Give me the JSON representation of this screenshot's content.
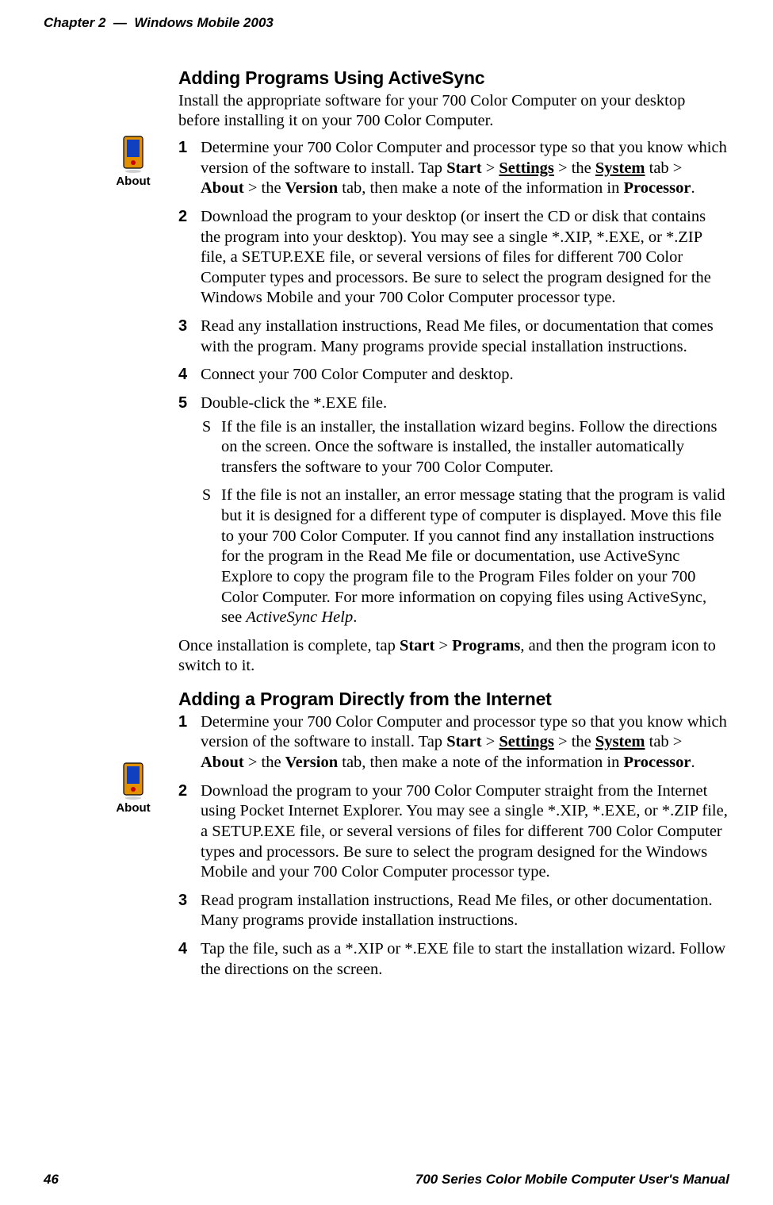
{
  "header": {
    "chapter": "Chapter 2",
    "dash": "—",
    "subject": "Windows Mobile 2003"
  },
  "footer": {
    "pageNum": "46",
    "manualTitle": "700 Series Color Mobile Computer User's Manual"
  },
  "icon": {
    "caption": "About"
  },
  "s1": {
    "title": "Adding Programs Using ActiveSync",
    "intro": "Install the appropriate software for your 700 Color Computer on your desktop before installing it on your 700 Color Computer.",
    "items": [
      {
        "n": "1",
        "pre1": "Determine your 700 Color Computer and processor type so that you know which version of the software to install. Tap ",
        "b1": "Start",
        "gt1": " > ",
        "u1": "Settings",
        "gt2": " > the ",
        "u2": "System",
        "post1": " tab > ",
        "b2": "About",
        "gt3": " > the ",
        "b3": "Version",
        "post2": " tab, then make a note of the information in ",
        "b4": "Processor",
        "post3": "."
      },
      {
        "n": "2",
        "text": "Download the program to your desktop (or insert the CD or disk that contains the program into your desktop). You may see a single *.XIP, *.EXE, or *.ZIP file, a SETUP.EXE file, or several versions of files for different 700 Color Computer types and processors. Be sure to select the program designed for the Windows Mobile and your 700 Color Computer processor type."
      },
      {
        "n": "3",
        "text": "Read any installation instructions, Read Me files, or documentation that comes with the program. Many programs provide special installation instructions."
      },
      {
        "n": "4",
        "text": "Connect your 700 Color Computer and desktop."
      },
      {
        "n": "5",
        "text": "Double-click the *.EXE file.",
        "sub": [
          "If the file is an installer, the installation wizard begins. Follow the directions on the screen. Once the software is installed, the installer automatically transfers the software to your 700 Color Computer.",
          {
            "pre": "If the file is not an installer, an error message stating that the program is valid but it is designed for a different type of computer is displayed. Move this file to your 700 Color Computer. If you cannot find any installation instructions for the program in the Read Me file or documentation, use ActiveSync Explore to copy the program file to the Program Files folder on your 700 Color Computer. For more information on copying files using ActiveSync, see ",
            "ital": "ActiveSync Help",
            "post": "."
          }
        ]
      }
    ],
    "outro": {
      "pre": "Once installation is complete, tap ",
      "b1": "Start",
      "gt": " > ",
      "b2": "Programs",
      "post": ", and then the program icon to switch to it."
    }
  },
  "s2": {
    "title": "Adding a Program Directly from the Internet",
    "items": [
      {
        "n": "1",
        "pre1": "Determine your 700 Color Computer and processor type so that you know which version of the software to install. Tap ",
        "b1": "Start",
        "gt1": " > ",
        "u1": "Settings",
        "gt2": " > the ",
        "u2": "System",
        "post1": " tab > ",
        "b2": "About",
        "gt3": " > the ",
        "b3": "Version",
        "post2": " tab, then make a note of the information in ",
        "b4": "Processor",
        "post3": "."
      },
      {
        "n": "2",
        "text": "Download the program to your 700 Color Computer straight from the Internet using Pocket Internet Explorer. You may see a single *.XIP, *.EXE, or *.ZIP file, a SETUP.EXE file, or several versions of files for different 700 Color Computer types and processors. Be sure to select the program designed for the Windows Mobile and your 700 Color Computer processor type."
      },
      {
        "n": "3",
        "text": "Read program installation instructions, Read Me files, or other documentation. Many programs provide installation instructions."
      },
      {
        "n": "4",
        "text": "Tap the file, such as a *.XIP or *.EXE file to start the installation wizard. Follow the directions on the screen."
      }
    ]
  }
}
